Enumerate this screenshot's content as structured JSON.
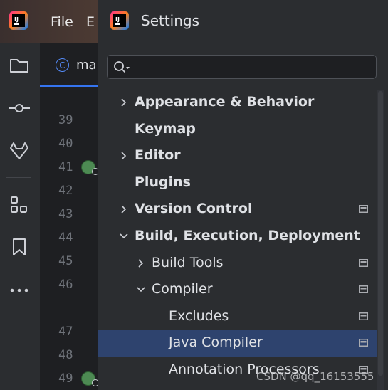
{
  "ide": {
    "menu": [
      {
        "label": "File"
      },
      {
        "label": "E"
      }
    ],
    "editor_tab": {
      "icon": "class-c-icon",
      "label": "ma"
    },
    "line_numbers": [
      "39",
      "40",
      "41",
      "42",
      "43",
      "44",
      "45",
      "46",
      "47",
      "48",
      "49"
    ],
    "gutter_icons_on_lines": [
      "41",
      "49"
    ]
  },
  "settings": {
    "title": "Settings",
    "search": {
      "value": "",
      "placeholder": ""
    },
    "tree": [
      {
        "label": "Appearance & Behavior",
        "level": 0,
        "expandable": true,
        "expanded": false,
        "project_icon": false,
        "selected": false
      },
      {
        "label": "Keymap",
        "level": 0,
        "expandable": false,
        "project_icon": false,
        "selected": false
      },
      {
        "label": "Editor",
        "level": 0,
        "expandable": true,
        "expanded": false,
        "project_icon": false,
        "selected": false
      },
      {
        "label": "Plugins",
        "level": 0,
        "expandable": false,
        "project_icon": false,
        "selected": false
      },
      {
        "label": "Version Control",
        "level": 0,
        "expandable": true,
        "expanded": false,
        "project_icon": true,
        "selected": false
      },
      {
        "label": "Build, Execution, Deployment",
        "level": 0,
        "expandable": true,
        "expanded": true,
        "project_icon": false,
        "selected": false
      },
      {
        "label": "Build Tools",
        "level": 1,
        "expandable": true,
        "expanded": false,
        "project_icon": true,
        "selected": false
      },
      {
        "label": "Compiler",
        "level": 1,
        "expandable": true,
        "expanded": true,
        "project_icon": true,
        "selected": false
      },
      {
        "label": "Excludes",
        "level": 2,
        "expandable": false,
        "project_icon": true,
        "selected": false
      },
      {
        "label": "Java Compiler",
        "level": 2,
        "expandable": false,
        "project_icon": true,
        "selected": true
      },
      {
        "label": "Annotation Processors",
        "level": 2,
        "expandable": false,
        "project_icon": true,
        "selected": false
      }
    ]
  },
  "watermark": "CSDN @qq_16153555",
  "colors": {
    "selection": "#2e436e",
    "dialog_bg": "#2b2d30",
    "editor_bg": "#1e1f22",
    "accent": "#3574f0"
  }
}
